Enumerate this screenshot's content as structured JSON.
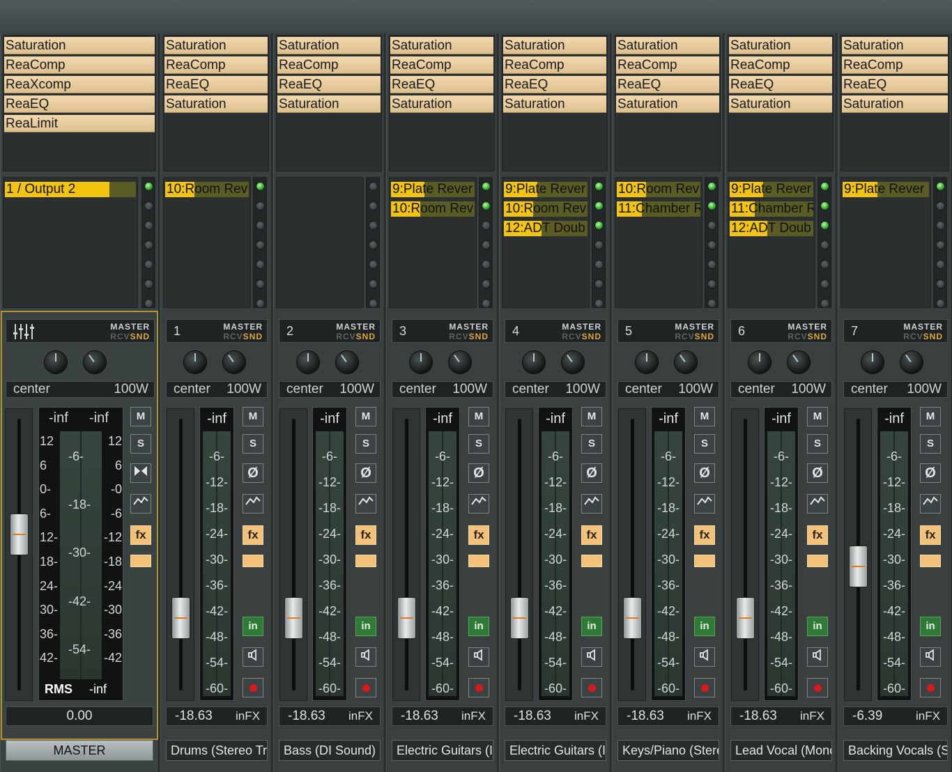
{
  "master": {
    "fx": [
      "Saturation",
      "ReaComp",
      "ReaXcomp",
      "ReaEQ",
      "ReaLimit"
    ],
    "sends": [
      {
        "label": "1 / Output 2",
        "level": 0.8,
        "active": true
      }
    ],
    "header": {
      "master_label": "MASTER",
      "rcv_label": "RCV",
      "snd_label": "SND",
      "icon": "mixer-settings-icon"
    },
    "pan": "center",
    "width": "100W",
    "meter": {
      "peak_left": "-inf",
      "peak_right": "-inf",
      "rms_label": "RMS",
      "rms_value": "-inf"
    },
    "scale_left": [
      "12",
      "6",
      "0-",
      "6-",
      "12-",
      "18-",
      "24-",
      "30-",
      "36-",
      "42-"
    ],
    "scale_right": [
      "12",
      "6",
      "-0",
      "-6",
      "-12",
      "-18",
      "-24",
      "-30",
      "-36",
      "-42"
    ],
    "scale_mid": [
      "-6-",
      "-18-",
      "-30-",
      "-42-",
      "-54-"
    ],
    "buttons": [
      "M",
      "S",
      "mono-icon",
      "envelope-icon",
      "fx"
    ],
    "fader_level": 0.0,
    "volume": "0.00",
    "name": "MASTER"
  },
  "tracks": [
    {
      "num": "1",
      "name": "Drums (Stereo Tr",
      "fx": [
        "Saturation",
        "ReaComp",
        "ReaEQ",
        "Saturation"
      ],
      "sends": [
        {
          "label": "10:Room Rev",
          "level": 0.35,
          "active": true
        }
      ],
      "volume": "-18.63"
    },
    {
      "num": "2",
      "name": "Bass (DI Sound)",
      "fx": [
        "Saturation",
        "ReaComp",
        "ReaEQ",
        "Saturation"
      ],
      "sends": [],
      "volume": "-18.63"
    },
    {
      "num": "3",
      "name": "Electric Guitars (I",
      "fx": [
        "Saturation",
        "ReaComp",
        "ReaEQ",
        "Saturation"
      ],
      "sends": [
        {
          "label": "9:Plate Rever",
          "level": 0.4,
          "active": true
        },
        {
          "label": "10:Room Rev",
          "level": 0.35,
          "active": true
        }
      ],
      "volume": "-18.63"
    },
    {
      "num": "4",
      "name": "Electric Guitars (I",
      "fx": [
        "Saturation",
        "ReaComp",
        "ReaEQ",
        "Saturation"
      ],
      "sends": [
        {
          "label": "9:Plate Rever",
          "level": 0.4,
          "active": true
        },
        {
          "label": "10:Room Rev",
          "level": 0.35,
          "active": true
        },
        {
          "label": "12:ADT Doub",
          "level": 0.45,
          "active": true
        }
      ],
      "volume": "-18.63"
    },
    {
      "num": "5",
      "name": "Keys/Piano (Stere",
      "fx": [
        "Saturation",
        "ReaComp",
        "ReaEQ",
        "Saturation"
      ],
      "sends": [
        {
          "label": "10:Room Rev",
          "level": 0.35,
          "active": true
        },
        {
          "label": "11:Chamber R",
          "level": 0.3,
          "active": true
        }
      ],
      "volume": "-18.63"
    },
    {
      "num": "6",
      "name": "Lead Vocal (Mono",
      "fx": [
        "Saturation",
        "ReaComp",
        "ReaEQ",
        "Saturation"
      ],
      "sends": [
        {
          "label": "9:Plate Rever",
          "level": 0.4,
          "active": true
        },
        {
          "label": "11:Chamber R",
          "level": 0.3,
          "active": true
        },
        {
          "label": "12:ADT Doub",
          "level": 0.45,
          "active": true
        }
      ],
      "volume": "-18.63"
    },
    {
      "num": "7",
      "name": "Backing Vocals (S",
      "fx": [
        "Saturation",
        "ReaComp",
        "ReaEQ",
        "Saturation"
      ],
      "sends": [
        {
          "label": "9:Plate Rever",
          "level": 0.4,
          "active": true
        }
      ],
      "volume": "-6.39"
    }
  ],
  "track_common": {
    "master_label": "MASTER",
    "rcv_label": "RCV",
    "snd_label": "SND",
    "pan": "center",
    "width": "100W",
    "meter_peak": "-inf",
    "meter_scale": [
      "-6-",
      "-12-",
      "-18-",
      "-24-",
      "-30-",
      "-36-",
      "-42-",
      "-48-",
      "-54-",
      "-60-"
    ],
    "buttons": [
      "M",
      "S",
      "phase-invert-icon",
      "envelope-icon",
      "fx",
      "in",
      "monitor-speaker-icon",
      "record-arm-icon"
    ],
    "infx_label": "inFX"
  },
  "colors": {
    "fx_slot": "#f2d9ad",
    "send_level": "#f2c40f",
    "master_frame": "#b5932c",
    "fx_button": "#f2c27b",
    "in_button": "#2f7a36",
    "record": "#d9191b"
  }
}
